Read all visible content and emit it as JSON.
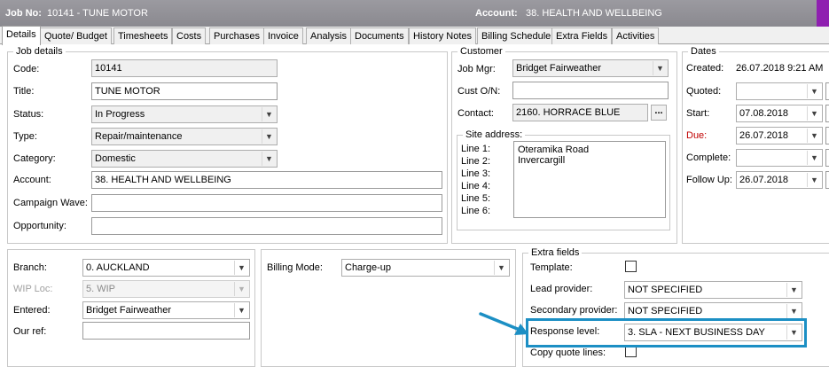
{
  "title_bar": {
    "job_label": "Job No:",
    "job_value": "10141 - TUNE MOTOR",
    "account_label": "Account:",
    "account_value": "38. HEALTH AND WELLBEING"
  },
  "tabs": [
    "Details",
    "Quote/ Budget",
    "Timesheets",
    "Costs",
    "Purchases",
    "Invoice",
    "Analysis",
    "Documents",
    "History Notes",
    "Billing Schedule",
    "Extra Fields",
    "Activities"
  ],
  "job_details": {
    "group_label": "Job details",
    "code_label": "Code:",
    "code_value": "10141",
    "title_label": "Title:",
    "title_value": "TUNE MOTOR",
    "status_label": "Status:",
    "status_value": "In Progress",
    "type_label": "Type:",
    "type_value": "Repair/maintenance",
    "category_label": "Category:",
    "category_value": "Domestic",
    "account_label": "Account:",
    "account_value": "38. HEALTH AND WELLBEING",
    "campaign_label": "Campaign Wave:",
    "campaign_value": "",
    "opportunity_label": "Opportunity:",
    "opportunity_value": ""
  },
  "customer": {
    "group_label": "Customer",
    "job_mgr_label": "Job Mgr:",
    "job_mgr_value": "Bridget Fairweather",
    "cust_on_label": "Cust O/N:",
    "cust_on_value": "",
    "contact_label": "Contact:",
    "contact_value": "2160. HORRACE BLUE",
    "ellipsis": "...",
    "site_address": {
      "group_label": "Site address:",
      "line_labels": [
        "Line 1:",
        "Line 2:",
        "Line 3:",
        "Line 4:",
        "Line 5:",
        "Line 6:"
      ],
      "lines": [
        "Oteramika Road",
        "Invercargill"
      ]
    }
  },
  "dates": {
    "group_label": "Dates",
    "created_label": "Created:",
    "created_value": "26.07.2018  9:21 AM",
    "quoted_label": "Quoted:",
    "quoted_value": "",
    "start_label": "Start:",
    "start_value": "07.08.2018",
    "due_label": "Due:",
    "due_value": "26.07.2018",
    "complete_label": "Complete:",
    "complete_value": "",
    "follow_up_label": "Follow Up:",
    "follow_up_value": "26.07.2018"
  },
  "bottom_left": {
    "branch_label": "Branch:",
    "branch_value": "0. AUCKLAND",
    "wip_label": "WIP Loc:",
    "wip_value": "5. WIP",
    "entered_label": "Entered:",
    "entered_value": "Bridget Fairweather",
    "our_ref_label": "Our ref:",
    "our_ref_value": ""
  },
  "billing": {
    "mode_label": "Billing Mode:",
    "mode_value": "Charge-up"
  },
  "extra_fields": {
    "group_label": "Extra fields",
    "template_label": "Template:",
    "lead_label": "Lead provider:",
    "lead_value": "NOT SPECIFIED",
    "secondary_label": "Secondary provider:",
    "secondary_value": "NOT SPECIFIED",
    "response_label": "Response level:",
    "response_value": "3. SLA - NEXT BUSINESS DAY",
    "copy_label": "Copy quote lines:"
  },
  "icons": {
    "dropdown": "chevron-down-icon",
    "callout_arrow": "arrow-icon"
  },
  "colors": {
    "highlight": "#1c8fc4",
    "due_label": "#c00000",
    "title_bar": "#9b9aa0",
    "title_accent": "#8f1fb0"
  }
}
